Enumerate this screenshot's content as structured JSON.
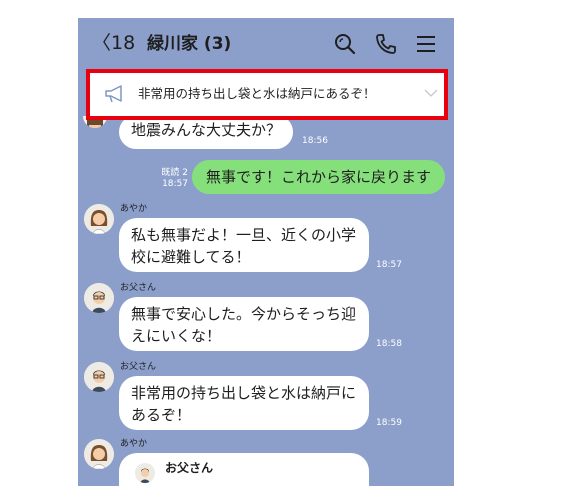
{
  "header": {
    "back_label": "〈18",
    "title": "緑川家 (3)",
    "icons": [
      "search-icon",
      "phone-icon",
      "menu-icon"
    ]
  },
  "pinned": {
    "text": "非常用の持ち出し袋と水は納戸にあるぞ！",
    "icon": "megaphone-icon"
  },
  "colors": {
    "chat_background": "#8c9fcb",
    "my_bubble": "#85e07b",
    "highlight_border": "#e8000f"
  },
  "messages": [
    {
      "text": "地震みんな大丈夫か？",
      "time": "18:56"
    },
    {
      "read": "既読 2",
      "time": "18:57",
      "text": "無事です！これから家に戻ります"
    },
    {
      "sender": "あやか",
      "line1": "私も無事だよ！一旦、近くの小学",
      "line2": "校に避難してる！",
      "time": "18:57"
    },
    {
      "sender": "お父さん",
      "line1": "無事で安心した。今からそっち迎",
      "line2": "えにいくな！",
      "time": "18:58"
    },
    {
      "sender": "お父さん",
      "line1": "非常用の持ち出し袋と水は納戸に",
      "line2": "あるぞ！",
      "time": "18:59"
    },
    {
      "sender": "あやか",
      "reply_name": "お父さん"
    }
  ]
}
